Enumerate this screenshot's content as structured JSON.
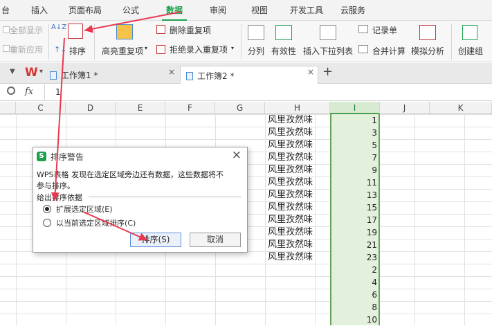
{
  "menu": {
    "tabs": [
      "台",
      "插入",
      "页面布局",
      "公式",
      "数据",
      "审阅",
      "视图",
      "开发工具",
      "云服务"
    ],
    "active": "数据"
  },
  "ribbon": {
    "show_all": "全部显示",
    "reapply": "重新应用",
    "sort_az": "A↓Z",
    "sort": "排序",
    "highlight_dup": "高亮重复项",
    "remove_dup": "删除重复项",
    "reject_dup": "拒绝录入重复项",
    "split": "分列",
    "validity": "有效性",
    "dropdown": "插入下拉列表",
    "record": "记录单",
    "consolidate": "合并计算",
    "what_if": "模拟分析",
    "create_group": "创建组"
  },
  "tabs": {
    "book1": "工作簿1 *",
    "book2": "工作簿2 *",
    "add": "+",
    "close": "×"
  },
  "formula": {
    "cell_icon": "search-icon",
    "fx": "fx",
    "value": "1"
  },
  "columns": [
    "C",
    "D",
    "E",
    "F",
    "G",
    "H",
    "I",
    "J",
    "K"
  ],
  "column_h": [
    "风里孜然味",
    "风里孜然味",
    "风里孜然味",
    "风里孜然味",
    "风里孜然味",
    "风里孜然味",
    "风里孜然味",
    "风里孜然味",
    "风里孜然味",
    "风里孜然味",
    "风里孜然味",
    "风里孜然味"
  ],
  "column_i": [
    "1",
    "3",
    "5",
    "7",
    "9",
    "11",
    "13",
    "15",
    "17",
    "19",
    "21",
    "23",
    "2",
    "4",
    "6",
    "8",
    "10"
  ],
  "dialog": {
    "title": "排序警告",
    "message_line1": "WPS表格 发现在选定区域旁边还有数据，这些数据将不",
    "message_line2": "参与排序。",
    "group": "给出排序依据",
    "option_expand": "扩展选定区域(E)",
    "option_current": "以当前选定区域排序(C)",
    "sort_btn": "排序(S)",
    "cancel_btn": "取消",
    "close": "×",
    "logo": "S"
  },
  "colors": {
    "accent": "#1aa14b",
    "selection": "#e3f0dc",
    "arrow": "#e8384f"
  }
}
